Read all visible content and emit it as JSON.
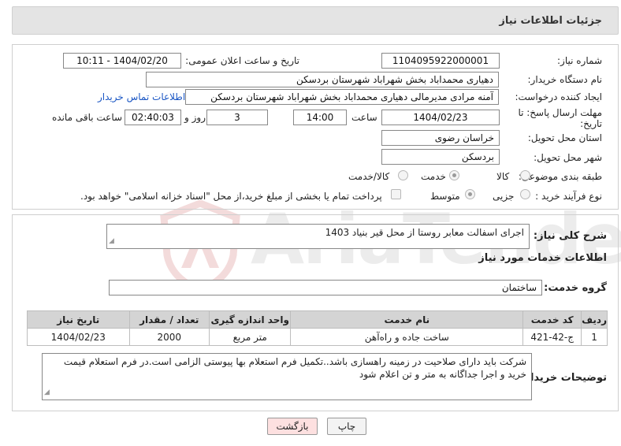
{
  "header": {
    "title": "جزئیات اطلاعات نیاز"
  },
  "need_number": {
    "label": "شماره نیاز:",
    "value": "1104095922000001"
  },
  "announce_datetime": {
    "label": "تاریخ و ساعت اعلان عمومی:",
    "value": "1404/02/20 - 10:11"
  },
  "buyer_org": {
    "label": "نام دستگاه خریدار:",
    "value": "دهیاری محمداباد بخش شهراباد شهرستان بردسکن"
  },
  "creator": {
    "label": "ایجاد کننده درخواست:",
    "value": "آمنه مرادی مدیرمالی دهیاری محمداباد بخش شهراباد شهرستان بردسکن",
    "contact_link": "اطلاعات تماس خریدار"
  },
  "deadline": {
    "label_line1": "مهلت ارسال پاسخ: تا",
    "label_line2": "تاریخ:",
    "date": "1404/02/23",
    "time_label": "ساعت",
    "time": "14:00",
    "days_label": "روز و",
    "days": "3",
    "remaining": "02:40:03",
    "remaining_label": "ساعت باقی مانده"
  },
  "province": {
    "label": "استان محل تحویل:",
    "value": "خراسان رضوی"
  },
  "city": {
    "label": "شهر محل تحویل:",
    "value": "بردسکن"
  },
  "category": {
    "label": "طبقه بندی موضوعی:",
    "options": [
      "کالا",
      "خدمت",
      "کالا/خدمت"
    ],
    "selected": "خدمت"
  },
  "purchase_type": {
    "label": "نوع فرآیند خرید :",
    "options": [
      "جزیی",
      "متوسط"
    ],
    "selected": "متوسط",
    "payment_note": "پرداخت تمام یا بخشی از مبلغ خرید،از محل \"اسناد خزانه اسلامی\" خواهد بود."
  },
  "summary": {
    "label": "شرح کلی نیاز:",
    "value": "اجرای اسفالت معابر روستا از محل قیر بنیاد 1403"
  },
  "services_title": "اطلاعات خدمات مورد نیاز",
  "service_group": {
    "label": "گروه خدمت:",
    "value": "ساختمان"
  },
  "table": {
    "headers": [
      "ردیف",
      "کد خدمت",
      "نام خدمت",
      "واحد اندازه گیری",
      "تعداد / مقدار",
      "تاریخ نیاز"
    ],
    "rows": [
      [
        "1",
        "ج-42-421",
        "ساخت جاده و راه‌آهن",
        "متر مربع",
        "2000",
        "1404/02/23"
      ]
    ]
  },
  "buyer_notes": {
    "label": "توضیحات خریدار:",
    "value": "شرکت  باید دارای صلاحیت در زمینه راهسازی باشد..تکمیل فرم استعلام بها پیوستی الزامی است.در فرم استعلام قیمت خرید و اجرا جداگانه به متر و تن اعلام شود"
  },
  "buttons": {
    "print": "چاپ",
    "back": "بازگشت"
  },
  "watermark": {
    "text": "AriaTender.neT"
  }
}
